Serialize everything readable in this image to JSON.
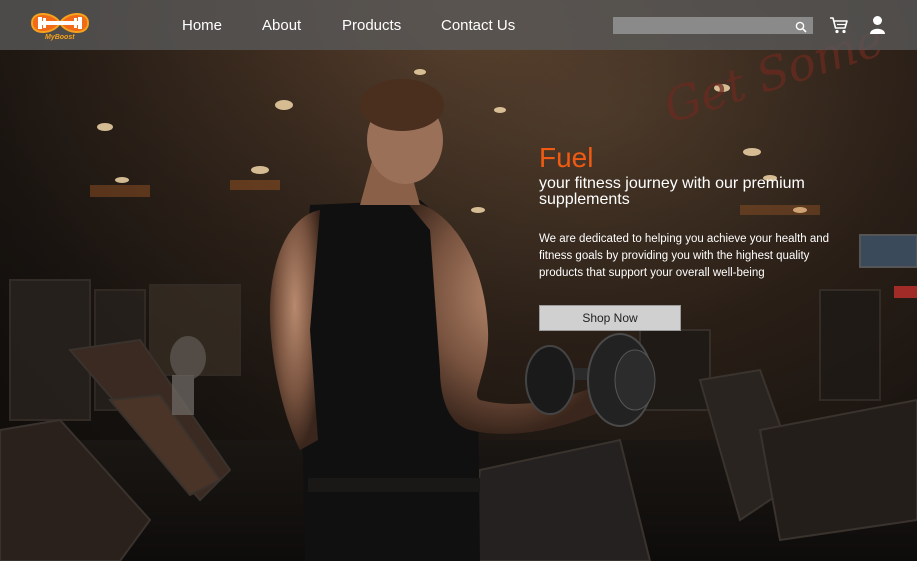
{
  "brand": {
    "logo_text": "MyBoost"
  },
  "nav": {
    "links": [
      {
        "label": "Home"
      },
      {
        "label": "About"
      },
      {
        "label": "Products"
      },
      {
        "label": "Contact Us"
      }
    ]
  },
  "search": {
    "placeholder": "",
    "value": ""
  },
  "icons": {
    "search": "search-icon",
    "cart": "cart-icon",
    "user": "user-icon"
  },
  "background": {
    "wall_sign_text": "Get Some"
  },
  "hero": {
    "title": "Fuel",
    "subtitle": "your fitness journey with our premium supplements",
    "description": "We are dedicated to helping you achieve your health and fitness goals by providing you with the highest quality products that support your overall well-being",
    "cta_label": "Shop Now"
  },
  "colors": {
    "accent": "#f05a12",
    "navbar": "#5a5a5a",
    "button": "#d0d0d0"
  }
}
